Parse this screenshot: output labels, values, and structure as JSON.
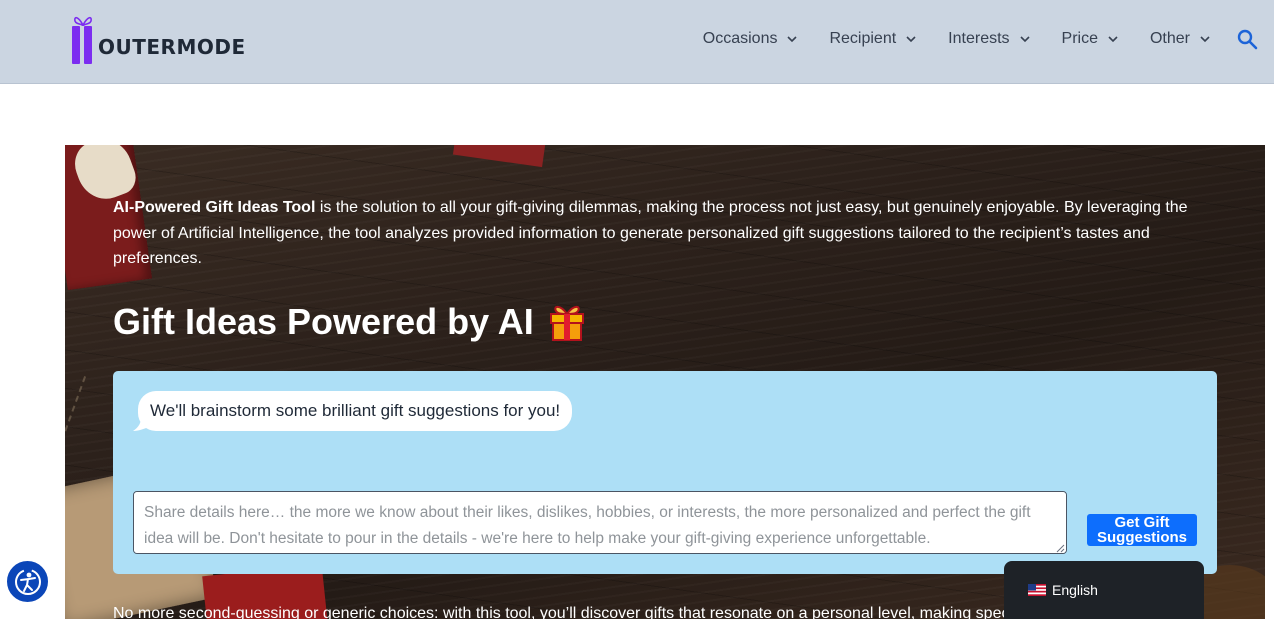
{
  "header": {
    "logo_text": "OUTERMODE",
    "nav": [
      {
        "label": "Occasions"
      },
      {
        "label": "Recipient"
      },
      {
        "label": "Interests"
      },
      {
        "label": "Price"
      },
      {
        "label": "Other"
      }
    ],
    "search_icon": "search-icon"
  },
  "hero": {
    "intro_bold": "AI-Powered Gift Ideas Tool",
    "intro_rest": " is the solution to all your gift-giving dilemmas, making the process not just easy, but genuinely enjoyable. By leveraging the power of Artificial Intelligence, the tool analyzes provided information to generate personalized gift suggestions tailored to the recipient’s tastes and preferences.",
    "title": "Gift Ideas Powered by AI",
    "title_icon": "wrapped-gift-icon",
    "chat": {
      "bubble_text": "We'll brainstorm some brilliant gift suggestions for you!",
      "input_placeholder": "Share details here… the more we know about their likes, dislikes, hobbies, or interests, the more personalized and perfect the gift idea will be. Don't hesitate to pour in the details - we're here to help make your gift-giving experience unforgettable.",
      "input_value": "",
      "submit_label": "Get Gift Suggestions"
    },
    "bottom_text": "No more second-guessing or generic choices: with this tool, you’ll discover gifts that resonate on a personal level, making spec"
  },
  "widgets": {
    "accessibility_icon": "accessibility-icon",
    "language": "English",
    "flag_icon": "us-flag-icon"
  },
  "colors": {
    "header_bg": "#cbd5e1",
    "brand_purple": "#7c2df0",
    "chat_panel_bg": "#addff6",
    "button_blue": "#0d6efd",
    "language_bar_bg": "#1e2227",
    "accessibility_blue": "#0b46b8"
  }
}
